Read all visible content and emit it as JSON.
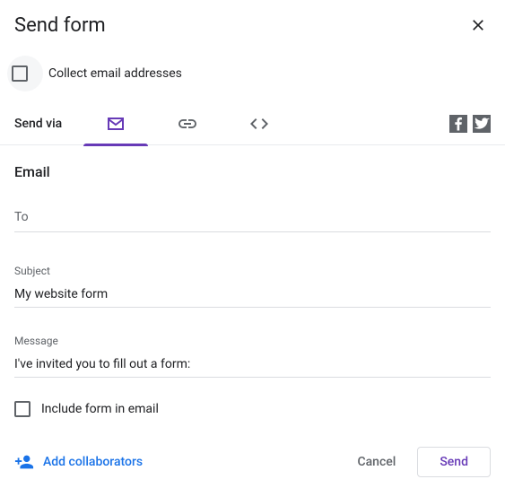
{
  "header": {
    "title": "Send form",
    "close_icon": "close"
  },
  "collect": {
    "label": "Collect email addresses",
    "checked": false
  },
  "sendvia": {
    "label": "Send via",
    "tabs": [
      {
        "id": "email",
        "label": "Email",
        "active": true
      },
      {
        "id": "link",
        "label": "Link",
        "active": false
      },
      {
        "id": "embed",
        "label": "Embed",
        "active": false
      }
    ],
    "social": {
      "facebook": "facebook",
      "twitter": "twitter"
    },
    "colors": {
      "accent": "#673ab7"
    }
  },
  "email": {
    "section_title": "Email",
    "to": {
      "label": "To",
      "placeholder": "To",
      "value": ""
    },
    "subject": {
      "label": "Subject",
      "value": "My website form"
    },
    "message": {
      "label": "Message",
      "value": "I've invited you to fill out a form:"
    }
  },
  "include": {
    "label": "Include form in email",
    "checked": false
  },
  "footer": {
    "add_collaborators": "Add collaborators",
    "cancel": "Cancel",
    "send": "Send"
  }
}
